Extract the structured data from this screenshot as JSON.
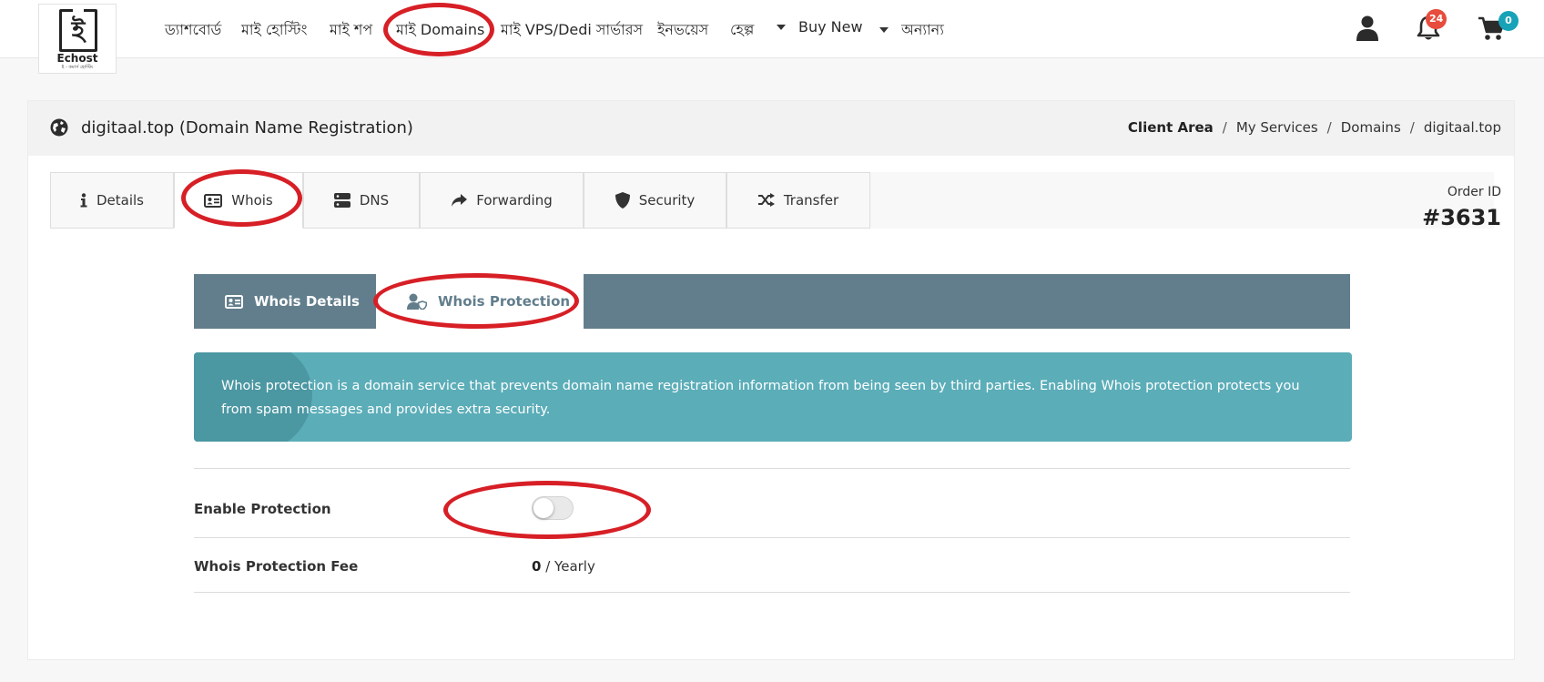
{
  "logo": {
    "glyph": "ই",
    "name": "Echost",
    "tagline": "ই - কমার্স হোস্টিং"
  },
  "nav": {
    "items": [
      "ড্যাশবোর্ড",
      "মাই হোস্টিং",
      "মাই শপ",
      "মাই Domains",
      "মাই VPS/Dedi সার্ভারস",
      "ইনভয়েস",
      "হেল্প",
      "Buy New",
      "অন্যান্য"
    ],
    "notifications_count": "24",
    "cart_count": "0"
  },
  "page": {
    "title": "digitaal.top (Domain Name Registration)",
    "breadcrumb": [
      "Client Area",
      "My Services",
      "Domains",
      "digitaal.top"
    ],
    "breadcrumb_sep": "/",
    "order_id_label": "Order ID",
    "order_id": "#3631"
  },
  "tabs": [
    "Details",
    "Whois",
    "DNS",
    "Forwarding",
    "Security",
    "Transfer"
  ],
  "subtabs": [
    "Whois Details",
    "Whois Protection"
  ],
  "info_text": "Whois protection is a domain service that prevents domain name registration information from being seen by third parties. Enabling Whois protection protects you from spam messages and provides extra security.",
  "protection": {
    "enable_label": "Enable Protection",
    "enabled": false,
    "fee_label": "Whois Protection Fee",
    "fee_value": "0",
    "fee_period": "/ Yearly"
  },
  "colors": {
    "subtab_bg": "#627e8c",
    "info_bg": "#5badb8",
    "highlight": "#d71f26",
    "notif_badge": "#e74c3c",
    "cart_badge": "#17a2b8"
  },
  "icons": [
    "user-icon",
    "bell-icon",
    "cart-icon",
    "globe-icon",
    "info-icon",
    "id-card-icon",
    "server-icon",
    "share-icon",
    "shield-icon",
    "shuffle-icon",
    "user-shield-icon"
  ]
}
